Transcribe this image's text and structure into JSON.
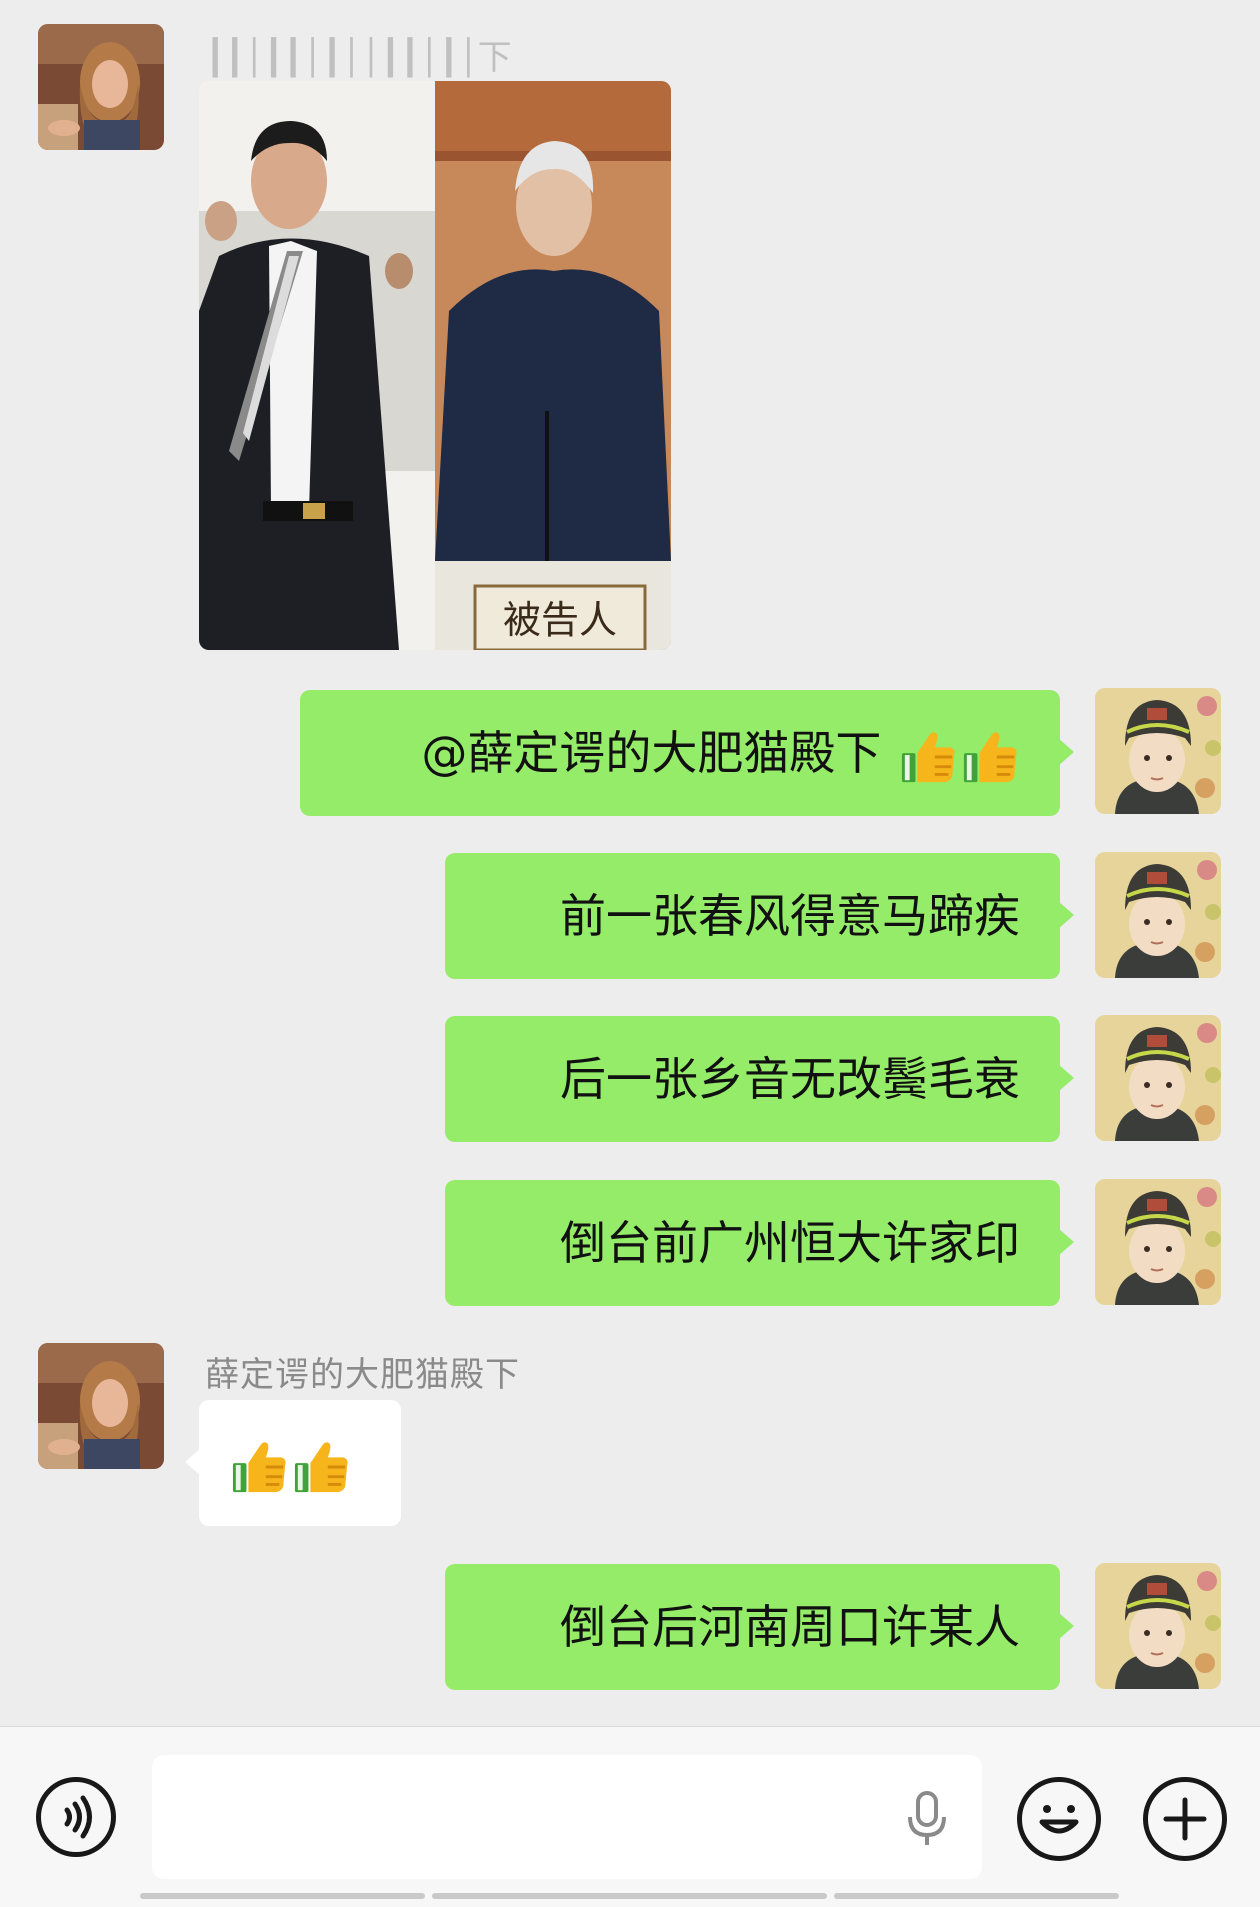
{
  "chat": {
    "messages": [
      {
        "sender": "other",
        "name": "薛定谔的大肥猫殿下",
        "type": "image",
        "image_caption": "被告人"
      },
      {
        "sender": "me",
        "type": "text",
        "text": "@薛定谔的大肥猫殿下 ",
        "emoji": [
          "thumbs-up",
          "thumbs-up"
        ]
      },
      {
        "sender": "me",
        "type": "text",
        "text": "前一张春风得意马蹄疾"
      },
      {
        "sender": "me",
        "type": "text",
        "text": "后一张乡音无改鬓毛衰"
      },
      {
        "sender": "me",
        "type": "text",
        "text": "倒台前广州恒大许家印"
      },
      {
        "sender": "other",
        "name": "薛定谔的大肥猫殿下",
        "type": "emoji",
        "emoji": [
          "thumbs-up",
          "thumbs-up"
        ]
      },
      {
        "sender": "me",
        "type": "text",
        "text": "倒台后河南周口许某人"
      }
    ],
    "first_name_visible": "下"
  },
  "input_bar": {
    "value": "",
    "icons": [
      "voice-icon",
      "mic-icon",
      "emoji-icon",
      "plus-icon"
    ]
  },
  "colors": {
    "background": "#ededed",
    "my_bubble": "#95ec69",
    "other_bubble": "#ffffff",
    "input_bar": "#f7f7f7"
  }
}
